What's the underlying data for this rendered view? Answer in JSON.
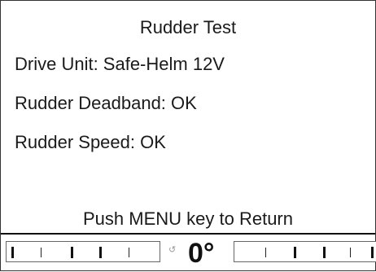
{
  "screen": {
    "title": "Rudder Test",
    "lines": [
      "Drive Unit: Safe-Helm 12V",
      "Rudder Deadband: OK",
      "Rudder Speed: OK"
    ],
    "footer_message": "Push MENU key to Return"
  },
  "rudder_indicator": {
    "angle_text": "0°",
    "rudder_angle_deg": 0,
    "arrow_icon": "rudder-direction-arrow-icon"
  }
}
